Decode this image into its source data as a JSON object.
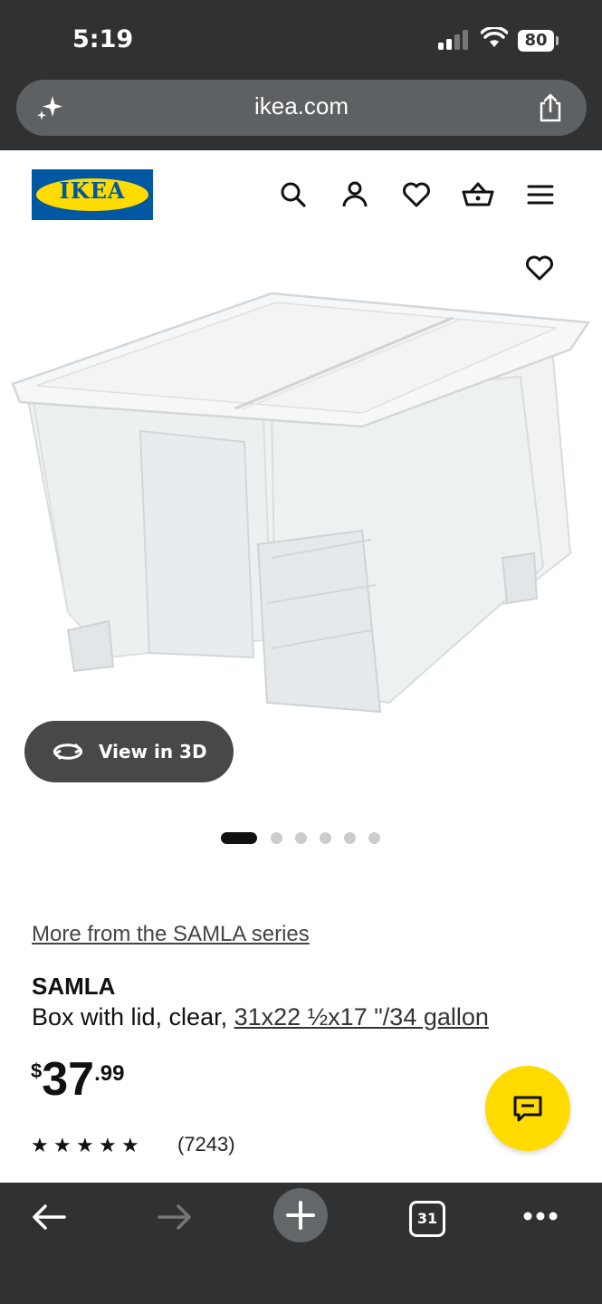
{
  "status_bar": {
    "time": "5:19",
    "battery": "80"
  },
  "browser": {
    "url": "ikea.com",
    "tabs_count": "31"
  },
  "header": {
    "logo_text": "IKEA",
    "brand_blue": "#0058a3",
    "brand_yellow": "#ffdb00"
  },
  "gallery": {
    "view_3d_label": "View in 3D",
    "image_count": 6,
    "active_index": 0
  },
  "product": {
    "series_link": "More from the SAMLA series",
    "name": "SAMLA",
    "desc_prefix": "Box with lid, clear, ",
    "desc_dimensions": "31x22 ½x17 \"/34 gallon",
    "price_currency": "$",
    "price_integer": "37",
    "price_cents": ".99",
    "rating_stars": 5,
    "review_count": "(7243)"
  },
  "icons": [
    "sparkle-icon",
    "share-icon",
    "search-icon",
    "account-icon",
    "favorite-icon",
    "cart-icon",
    "menu-icon",
    "rotate-3d-icon",
    "chat-icon",
    "back-arrow-icon",
    "forward-arrow-icon",
    "new-tab-icon",
    "more-icon"
  ]
}
